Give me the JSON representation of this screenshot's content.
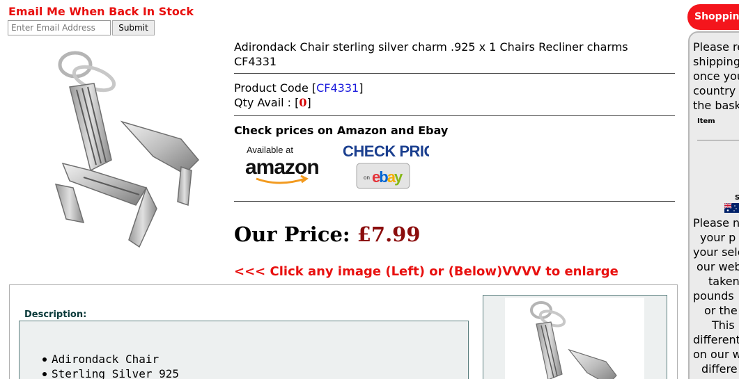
{
  "stock_alert": {
    "title": "Email Me When Back In Stock",
    "email_placeholder": "Enter Email Address",
    "submit_label": "Submit"
  },
  "product": {
    "title": "Adirondack Chair sterling silver charm .925 x 1 Chairs Recliner charms CF4331",
    "code_label": "Product Code [",
    "code_value": "CF4331",
    "code_close": "]",
    "qty_label": "Qty Avail : [",
    "qty_value": "0",
    "qty_close": "]",
    "check_prices_title": "Check prices on Amazon and Ebay",
    "amazon": {
      "available_text": "Available at",
      "brand": "amazon"
    },
    "ebay": {
      "check_price_text": "CHECK PRICE",
      "on_text": "on",
      "brand": "ebay"
    },
    "price_label": "Our Price: ",
    "price_value": "£7.99",
    "enlarge_note": "<<< Click any image (Left) or (Below)VVVV to enlarge"
  },
  "description": {
    "label": "Description:",
    "items": [
      "Adirondack Chair",
      "Sterling Silver 925"
    ]
  },
  "cart": {
    "tab_label": "Shopping Basket",
    "message_lines": [
      "Please re",
      "shipping",
      "once you",
      "country",
      "the bask"
    ],
    "item_header": "Item",
    "s_text": "S",
    "notice_lines": [
      "Please n",
      "your p",
      "your sele",
      "our web",
      "taken",
      "pounds",
      "or the",
      "This",
      "different",
      "on our w",
      "differe"
    ]
  },
  "colors": {
    "alert_red": "#e8100f",
    "price_maroon": "#8b0d0d",
    "link_blue": "#1a1adc",
    "panel_border": "#5b7f7f"
  }
}
